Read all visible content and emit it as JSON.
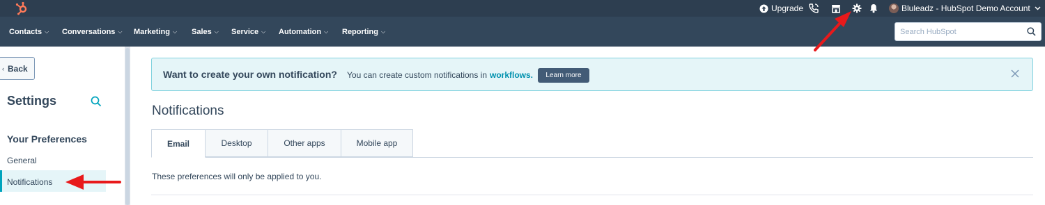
{
  "topbar": {
    "upgrade_label": "Upgrade",
    "account_name": "Bluleadz - HubSpot Demo Account",
    "icons": [
      "hubspot-sprocket-icon",
      "upgrade-icon",
      "phone-icon",
      "marketplace-icon",
      "gear-icon",
      "bell-icon",
      "avatar",
      "chevron-down-icon"
    ]
  },
  "nav": {
    "items": [
      {
        "label": "Contacts"
      },
      {
        "label": "Conversations"
      },
      {
        "label": "Marketing"
      },
      {
        "label": "Sales"
      },
      {
        "label": "Service"
      },
      {
        "label": "Automation"
      },
      {
        "label": "Reporting"
      }
    ],
    "search": {
      "placeholder": "Search HubSpot"
    }
  },
  "sidebar": {
    "back_label": "Back",
    "title": "Settings",
    "section_title": "Your Preferences",
    "links": [
      {
        "label": "General"
      },
      {
        "label": "Notifications",
        "active": true
      }
    ]
  },
  "banner": {
    "heading": "Want to create your own notification?",
    "body": "You can create custom notifications in",
    "link": "workflows.",
    "button": "Learn more"
  },
  "main": {
    "title": "Notifications",
    "tabs": [
      {
        "label": "Email",
        "active": true
      },
      {
        "label": "Desktop"
      },
      {
        "label": "Other apps"
      },
      {
        "label": "Mobile app"
      }
    ],
    "note": "These preferences will only be applied to you."
  },
  "colors": {
    "topbar": "#2d3e50",
    "navbar": "#33475b",
    "accent": "#00a4bd",
    "link": "#0091ae",
    "banner_bg": "#e5f5f8",
    "annotation_arrow": "#e8191b",
    "logo": "#ff7a59"
  }
}
